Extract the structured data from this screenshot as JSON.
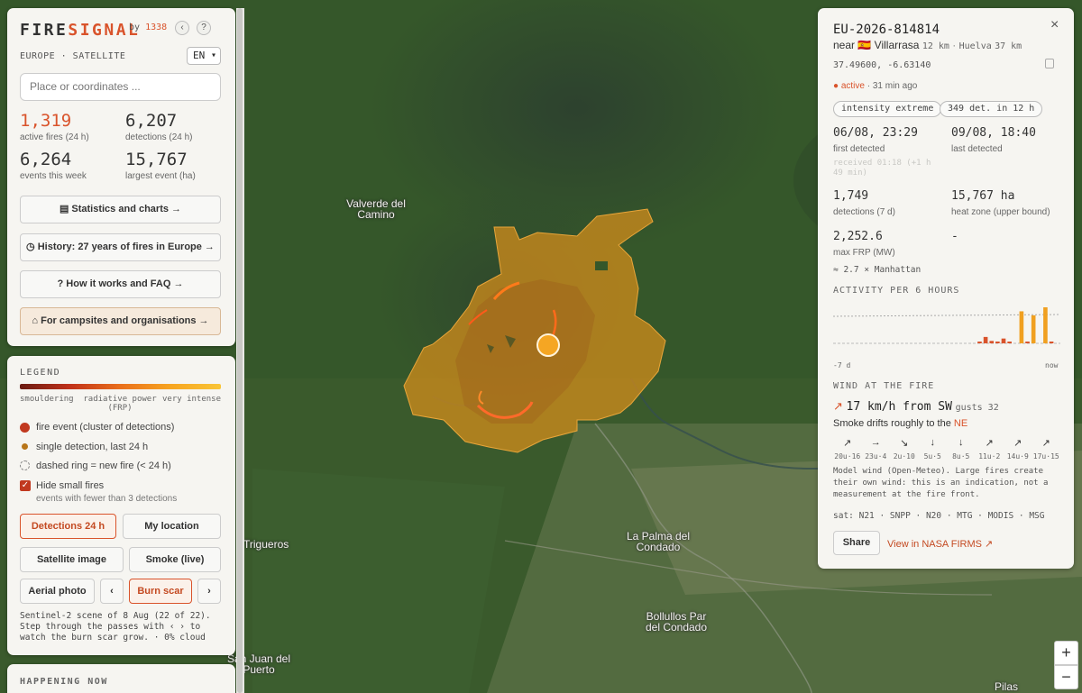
{
  "brand": {
    "name_a": "FIRE",
    "name_b": "SIGNAL",
    "by": "by",
    "by_value": "1338",
    "back_icon": "chevron-left-icon",
    "help_label": "?"
  },
  "region": {
    "label": "EUROPE · SATELLITE",
    "language": "EN"
  },
  "search": {
    "placeholder": "Place or coordinates ..."
  },
  "stats": [
    {
      "value": "1,319",
      "label": "active fires (24 h)",
      "color": "#d9532b"
    },
    {
      "value": "6,207",
      "label": "detections (24 h)"
    },
    {
      "value": "6,264",
      "label": "events this week"
    },
    {
      "value": "15,767",
      "label": "largest event (ha)"
    }
  ],
  "menu": [
    {
      "label": "▤ Statistics and charts →"
    },
    {
      "label": "◷ History: 27 years of fires in Europe →"
    },
    {
      "label": "? How it works and FAQ →"
    },
    {
      "label": "⌂ For campsites and organisations →"
    }
  ],
  "legend": {
    "title": "LEGEND",
    "scale_left": "smouldering",
    "scale_mid": "radiative power\n(FRP)",
    "scale_right": "very intense",
    "items": [
      {
        "label": "fire event (cluster of detections)"
      },
      {
        "label": "single detection, last 24 h"
      },
      {
        "label": "dashed ring = new fire (< 24 h)"
      }
    ],
    "hide_small": {
      "label": "Hide small fires",
      "sub": "events with fewer than 3 detections",
      "checked": true
    }
  },
  "controls": {
    "detections": "Detections 24 h",
    "my_location": "My location",
    "satellite": "Satellite image",
    "smoke": "Smoke (live)",
    "aerial": "Aerial photo",
    "prev": "‹",
    "burn_scar": "Burn scar",
    "next": "›",
    "note": "Sentinel-2 scene of 8 Aug (22 of 22).\nStep through the passes with ‹ › to\nwatch the burn scar grow. · 0% cloud"
  },
  "happening": {
    "title": "HAPPENING NOW"
  },
  "map_labels": {
    "valverde": "Valverde del\nCamino",
    "la_palma": "La Palma del\nCondado",
    "trigueros": "Trigueros",
    "bollullos": "Bollullos Par\ndel Condado",
    "san_juan": "San Juan del\nPuerto",
    "pilas": "Pilas"
  },
  "zoom": {
    "in": "+",
    "out": "−"
  },
  "event": {
    "id": "EU-2026-814814",
    "near_prefix": "near",
    "flag": "🇪🇸",
    "place": "Villarrasa",
    "place_dist": "12 km",
    "sep": "·",
    "place2": "Huelva",
    "place2_dist": "37 km",
    "coords": "37.49600, -6.63140",
    "status": "active",
    "status_age": "· 31 min ago",
    "pill_intensity": "intensity extreme",
    "pill_detections": "349 det. in 12 h",
    "first_detected": {
      "value": "06/08, 23:29",
      "label": "first detected"
    },
    "last_detected": {
      "value": "09/08, 18:40",
      "label": "last detected"
    },
    "received": "received 01:18 (+1 h\n49 min)",
    "detections_7d": {
      "value": "1,749",
      "label": "detections (7 d)"
    },
    "heat_zone": {
      "value": "15,767 ha",
      "label": "heat zone (upper bound)"
    },
    "max_frp": {
      "value": "2,252.6",
      "label": "max FRP (MW)"
    },
    "dash": "-",
    "manhattan": "≈ 2.7 × Manhattan",
    "activity_title": "ACTIVITY PER 6 HOURS",
    "activity_left": "-7 d",
    "activity_right": "now",
    "activity_bars": [
      0,
      0,
      0,
      0,
      0,
      0,
      0,
      0,
      0,
      0,
      0,
      0,
      0,
      0,
      0,
      0,
      0,
      0,
      0,
      0,
      0,
      0,
      0,
      0,
      2,
      8,
      3,
      2,
      6,
      2,
      0,
      40,
      2,
      35,
      0,
      45,
      1,
      0
    ],
    "wind_title": "WIND AT THE FIRE",
    "wind_speed": "17 km/h from SW",
    "wind_gusts": "gusts 32",
    "smoke_prefix": "Smoke drifts roughly to the",
    "smoke_dir": "NE",
    "forecast": [
      {
        "arrow": "↗",
        "label": "20u·16"
      },
      {
        "arrow": "→",
        "label": "23u·4"
      },
      {
        "arrow": "↘",
        "label": "2u·10"
      },
      {
        "arrow": "↓",
        "label": "5u·5"
      },
      {
        "arrow": "↓",
        "label": "8u·5"
      },
      {
        "arrow": "↗",
        "label": "11u·2"
      },
      {
        "arrow": "↗",
        "label": "14u·9"
      },
      {
        "arrow": "↗",
        "label": "17u·15"
      }
    ],
    "wind_note": "Model wind (Open-Meteo). Large fires create\ntheir own wind: this is an indication, not a\nmeasurement at the fire front.",
    "sats": "sat: N21 · SNPP · N20 · MTG · MODIS · MSG",
    "share": "Share",
    "firms": "View in NASA FIRMS ↗",
    "close": "×"
  }
}
